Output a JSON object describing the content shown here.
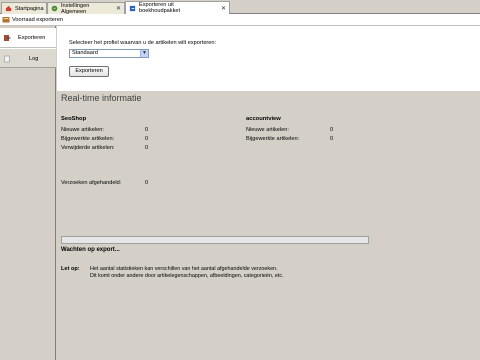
{
  "tabs": [
    {
      "label": "Startpagina",
      "icon": "home-icon",
      "active": false,
      "closable": false
    },
    {
      "label": "Instellingen Algemeen",
      "icon": "settings-globe-icon",
      "active": false,
      "closable": true
    },
    {
      "label": "Exporteren uit boekhoudpakket",
      "icon": "export-icon",
      "active": true,
      "closable": true
    }
  ],
  "toolbar": {
    "label": "Voorraad exporteren",
    "icon": "inventory-export-icon"
  },
  "nav": {
    "items": [
      {
        "label": "Exporteren",
        "icon": "export-icon"
      },
      {
        "label": "Log",
        "icon": "log-page-icon"
      }
    ]
  },
  "export_form": {
    "prompt": "Selecteer het profiel waarvan u de artikelen wilt exporteren:",
    "profile_value": "Standaard",
    "button_label": "Exporteren"
  },
  "realtime": {
    "title": "Real-time informatie",
    "left_column": {
      "heading": "SeoShop",
      "rows": [
        {
          "label": "Nieuwe artikelen:",
          "value": "0"
        },
        {
          "label": "Bijgewerkte artikelen:",
          "value": "0"
        },
        {
          "label": "Verwijderde artikelen:",
          "value": "0"
        }
      ],
      "requests_label": "Verzoeken afgehandeld:",
      "requests_value": "0"
    },
    "right_column": {
      "heading": "accountview",
      "rows": [
        {
          "label": "Nieuwe artikelen:",
          "value": "0"
        },
        {
          "label": "Bijgewerkte artikelen:",
          "value": "0"
        }
      ]
    },
    "progress": 0.0,
    "status": "Wachten op export...",
    "note_label": "Let op:",
    "note_lines": [
      "Het aantal statistieken kan verschillen van het aantal afgehandelde verzoeken.",
      "Dit komt onder andere door artikelegenschappen, afbeeldingen, categorieën, etc."
    ]
  },
  "colors": {
    "accent": "#7f9db9",
    "panel": "#d4d0c8"
  }
}
